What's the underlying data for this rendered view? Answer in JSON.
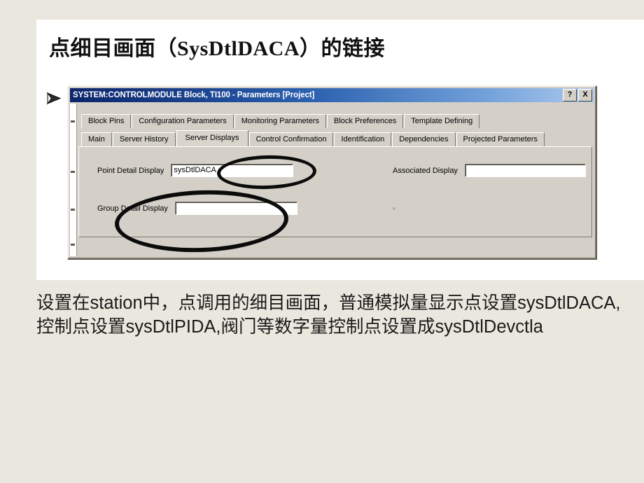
{
  "slide": {
    "title": "点细目画面（SysDtlDACA）的链接",
    "bullet_marker": "arrow-bullet",
    "ghost_line": "",
    "caption": "设置在station中，点调用的细目画面，普通模拟量显示点设置sysDtlDACA,控制点设置sysDtlPIDA,阀门等数字量控制点设置成sysDtlDevctla"
  },
  "dialog": {
    "title": "SYSTEM:CONTROLMODULE Block, TI100 - Parameters [Project]",
    "caption_buttons": {
      "help": "?",
      "close": "X"
    },
    "tab_row_1": [
      {
        "label": "Block Pins",
        "selected": false
      },
      {
        "label": "Configuration Parameters",
        "selected": false
      },
      {
        "label": "Monitoring Parameters",
        "selected": false
      },
      {
        "label": "Block Preferences",
        "selected": false
      },
      {
        "label": "Template Defining",
        "selected": false
      }
    ],
    "tab_row_2": [
      {
        "label": "Main",
        "selected": false
      },
      {
        "label": "Server History",
        "selected": false
      },
      {
        "label": "Server Displays",
        "selected": true
      },
      {
        "label": "Control Confirmation",
        "selected": false
      },
      {
        "label": "Identification",
        "selected": false
      },
      {
        "label": "Dependencies",
        "selected": false
      },
      {
        "label": "Projected Parameters",
        "selected": false
      }
    ],
    "fields": {
      "point_detail_display": {
        "label": "Point Detail Display",
        "value": "sysDtlDACA",
        "placeholder": ""
      },
      "associated_display": {
        "label": "Associated Display",
        "value": "",
        "placeholder": ""
      },
      "group_detail_display": {
        "label": "Group Detail Display",
        "value": "",
        "placeholder": ""
      }
    }
  },
  "colors": {
    "page_background": "#eae8de",
    "card_background": "#ffffff",
    "dialog_face": "#d4d0c8",
    "titlebar_start": "#0a246a",
    "titlebar_end": "#adc9ee",
    "annotation": "#0b0b0b",
    "text": "#1a1a1a"
  }
}
